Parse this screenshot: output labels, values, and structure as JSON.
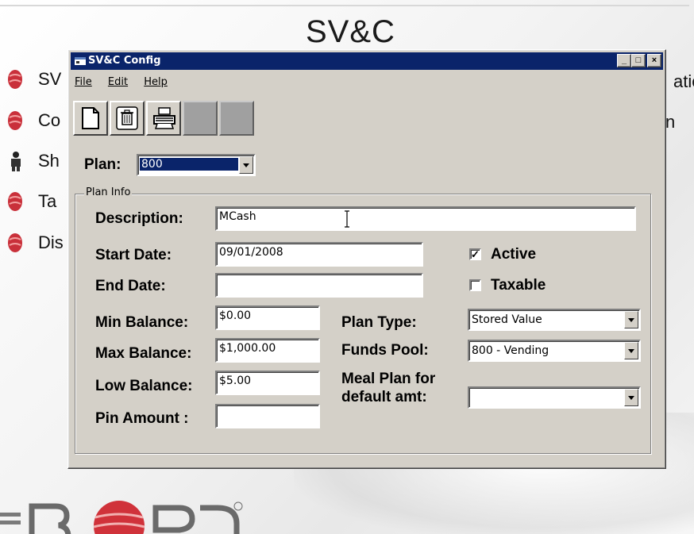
{
  "background": {
    "title": "SV&C",
    "menu_items": [
      {
        "label": "SV"
      },
      {
        "label": "Co"
      },
      {
        "label": "Sh"
      },
      {
        "label": "Ta"
      },
      {
        "label": "Dis"
      }
    ],
    "right_fragments": [
      "atic",
      "n"
    ]
  },
  "window": {
    "title": "SV&C Config",
    "controls": {
      "minimize": "_",
      "maximize": "□",
      "close": "×"
    }
  },
  "menu": {
    "file": "File",
    "edit": "Edit",
    "help": "Help"
  },
  "toolbar": {
    "buttons": [
      {
        "icon": "new-document-icon",
        "enabled": true
      },
      {
        "icon": "delete-trash-icon",
        "enabled": true
      },
      {
        "icon": "printer-icon",
        "enabled": true
      },
      {
        "icon": "blank",
        "enabled": false
      },
      {
        "icon": "blank",
        "enabled": false
      }
    ]
  },
  "plan": {
    "label": "Plan:",
    "value": "800"
  },
  "plan_info": {
    "legend": "Plan Info",
    "description": {
      "label": "Description:",
      "value": "MCash"
    },
    "start_date": {
      "label": "Start Date:",
      "value": "09/01/2008"
    },
    "end_date": {
      "label": "End Date:",
      "value": ""
    },
    "active": {
      "label": "Active",
      "checked": true
    },
    "taxable": {
      "label": "Taxable",
      "checked": false
    },
    "min_balance": {
      "label": "Min Balance:",
      "value": "$0.00"
    },
    "max_balance": {
      "label": "Max Balance:",
      "value": "$1,000.00"
    },
    "low_balance": {
      "label": "Low Balance:",
      "value": "$5.00"
    },
    "pin_amount": {
      "label": "Pin Amount :",
      "value": ""
    },
    "plan_type": {
      "label": "Plan Type:",
      "value": "Stored Value"
    },
    "funds_pool": {
      "label": "Funds Pool:",
      "value": "800 - Vending"
    },
    "meal_plan": {
      "label_line1": "Meal Plan for",
      "label_line2": "default amt:",
      "value": ""
    }
  },
  "colors": {
    "titlebar": "#0a246a",
    "dialog_face": "#d4d0c8",
    "bullet": "#d0323a"
  }
}
